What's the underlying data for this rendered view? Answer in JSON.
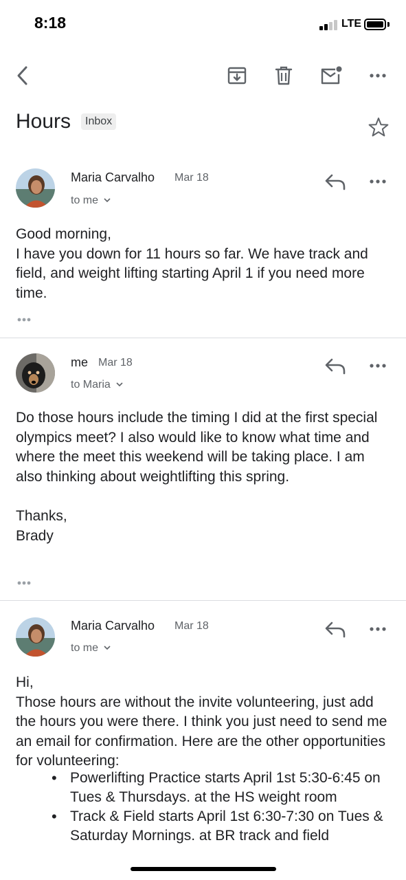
{
  "status": {
    "time": "8:18",
    "network": "LTE"
  },
  "subject": {
    "title": "Hours",
    "label": "Inbox"
  },
  "messages": [
    {
      "sender": "Maria Carvalho",
      "date": "Mar 18",
      "recipient": "to me",
      "body": "Good morning,\nI have you down for 11 hours so far. We have track and field, and weight lifting starting April 1 if you need more time."
    },
    {
      "sender": "me",
      "date": "Mar 18",
      "recipient": "to Maria",
      "body": "Do those hours include the timing I did at the first special olympics meet? I also would like to know what time and where the meet this weekend will be taking place. I am also thinking about weightlifting this spring.\n\nThanks,\nBrady"
    },
    {
      "sender": "Maria Carvalho",
      "date": "Mar 18",
      "recipient": "to me",
      "body": "Hi,\nThose hours are without the invite volunteering, just add the hours you were there. I think you just need to send me an email for confirmation. Here are the other opportunities for volunteering:",
      "bullets": [
        "Powerlifting Practice starts April 1st 5:30-6:45 on Tues & Thursdays. at the HS weight room",
        "Track & Field starts April 1st 6:30-7:30 on Tues & Saturday Mornings. at BR track and field"
      ]
    }
  ],
  "icons": {
    "back": "chevron-left-icon",
    "archive": "archive-icon",
    "delete": "trash-icon",
    "mark_unread": "mail-unread-icon",
    "more": "more-horizontal-icon",
    "star": "star-outline-icon",
    "reply": "reply-icon"
  },
  "colors": {
    "text": "#202124",
    "secondary": "#5f6368",
    "icon": "#5f6368",
    "chip_bg": "#eeeeee"
  }
}
